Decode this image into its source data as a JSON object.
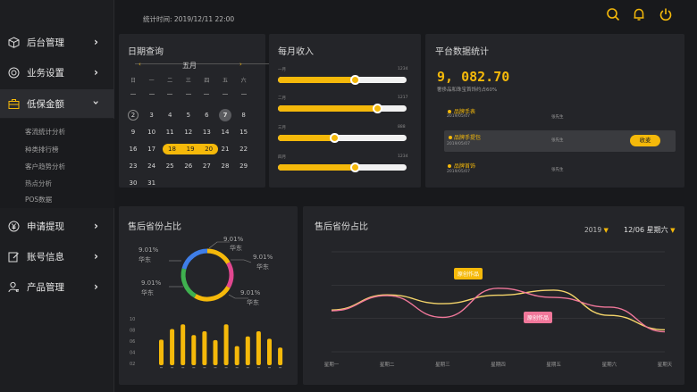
{
  "topbar": {
    "stat_time_label": "统计时间: 2019/12/11  22:00"
  },
  "sidebar": {
    "items": [
      {
        "label": "后台管理",
        "icon": "cube-icon"
      },
      {
        "label": "业务设置",
        "icon": "target-icon"
      },
      {
        "label": "低保金额",
        "icon": "briefcase-icon"
      },
      {
        "label": "申请提现",
        "icon": "yen-icon"
      },
      {
        "label": "账号信息",
        "icon": "edit-icon"
      },
      {
        "label": "产品管理",
        "icon": "user-icon"
      }
    ],
    "sub_items": [
      "客流统计分析",
      "种类排行榜",
      "客户趋势分析",
      "热点分析",
      "POS数据"
    ]
  },
  "date_panel": {
    "title": "日期查询",
    "month": "五月",
    "weekdays": [
      "日",
      "一",
      "二",
      "三",
      "四",
      "五",
      "六"
    ],
    "days": [
      [
        "",
        "",
        "",
        "",
        "",
        "",
        ""
      ],
      [
        "2",
        "3",
        "4",
        "5",
        "6",
        "7",
        "8"
      ],
      [
        "9",
        "10",
        "11",
        "12",
        "13",
        "14",
        "15"
      ],
      [
        "16",
        "17",
        "18",
        "19",
        "20",
        "21",
        "22"
      ],
      [
        "23",
        "24",
        "25",
        "26",
        "27",
        "28",
        "29"
      ],
      [
        "30",
        "31",
        "",
        "",
        "",
        "",
        ""
      ]
    ]
  },
  "monthly_income": {
    "title": "每月收入",
    "rows": [
      {
        "left": "一月",
        "right": "1234",
        "value": 0.6
      },
      {
        "left": "二月",
        "right": "1217",
        "value": 0.77
      },
      {
        "left": "三月",
        "right": "888",
        "value": 0.44
      },
      {
        "left": "四月",
        "right": "1234",
        "value": 0.6
      }
    ]
  },
  "platform": {
    "title": "平台数据统计",
    "total": "9, 082.70",
    "subtitle": "奢侈品和珠宝首饰约占60%",
    "items": [
      {
        "name": "品牌手表",
        "date": "2019/05/07",
        "person": "张先生"
      },
      {
        "name": "品牌手提包",
        "date": "2019/05/07",
        "person": "张先生"
      },
      {
        "name": "品牌首饰",
        "date": "2019/05/07",
        "person": "张先生"
      }
    ],
    "collect_label": "收麦"
  },
  "donut_panel": {
    "title": "售后省份占比",
    "labels": [
      {
        "pct": "9.01%",
        "name": "华东"
      },
      {
        "pct": "9.01%",
        "name": "华东"
      },
      {
        "pct": "9.01%",
        "name": "华东"
      },
      {
        "pct": "9.01%",
        "name": "华东"
      },
      {
        "pct": "9.01%",
        "name": "华东"
      }
    ],
    "bar_axis": [
      "10",
      "08",
      "06",
      "04",
      "02"
    ]
  },
  "line_panel": {
    "title": "售后省份占比",
    "year": "2019",
    "date": "12/06 星期六",
    "tag_top": "原创作品",
    "tag_bottom": "原创作品",
    "x_labels": [
      "星期一",
      "星期二",
      "星期三",
      "星期四",
      "星期五",
      "星期六",
      "星期天"
    ]
  },
  "chart_data": [
    {
      "type": "bar",
      "categories": [
        "",
        "",
        "",
        "",
        "",
        "",
        "",
        "",
        "",
        "",
        "",
        ""
      ],
      "values": [
        5.5,
        7.8,
        8.8,
        6.5,
        7.3,
        5.4,
        8.8,
        4.1,
        6.2,
        7.3,
        5.7,
        3.8
      ],
      "ylim": [
        0,
        10
      ]
    },
    {
      "type": "line",
      "x": [
        "星期一",
        "星期二",
        "星期三",
        "星期四",
        "星期五",
        "星期六",
        "星期天"
      ],
      "series": [
        {
          "color": "#f5d56a",
          "values": [
            40,
            57,
            41,
            62,
            59,
            40,
            22
          ]
        },
        {
          "color": "#f0779a",
          "values": [
            41,
            58,
            38,
            60,
            58,
            42,
            20
          ]
        }
      ],
      "colors": {
        "series_yellow": "#f5d56a",
        "series_pink": "#f0779a"
      }
    }
  ],
  "colors": {
    "accent": "#f5b90a",
    "panel": "#242529",
    "bg": "#18191c"
  }
}
